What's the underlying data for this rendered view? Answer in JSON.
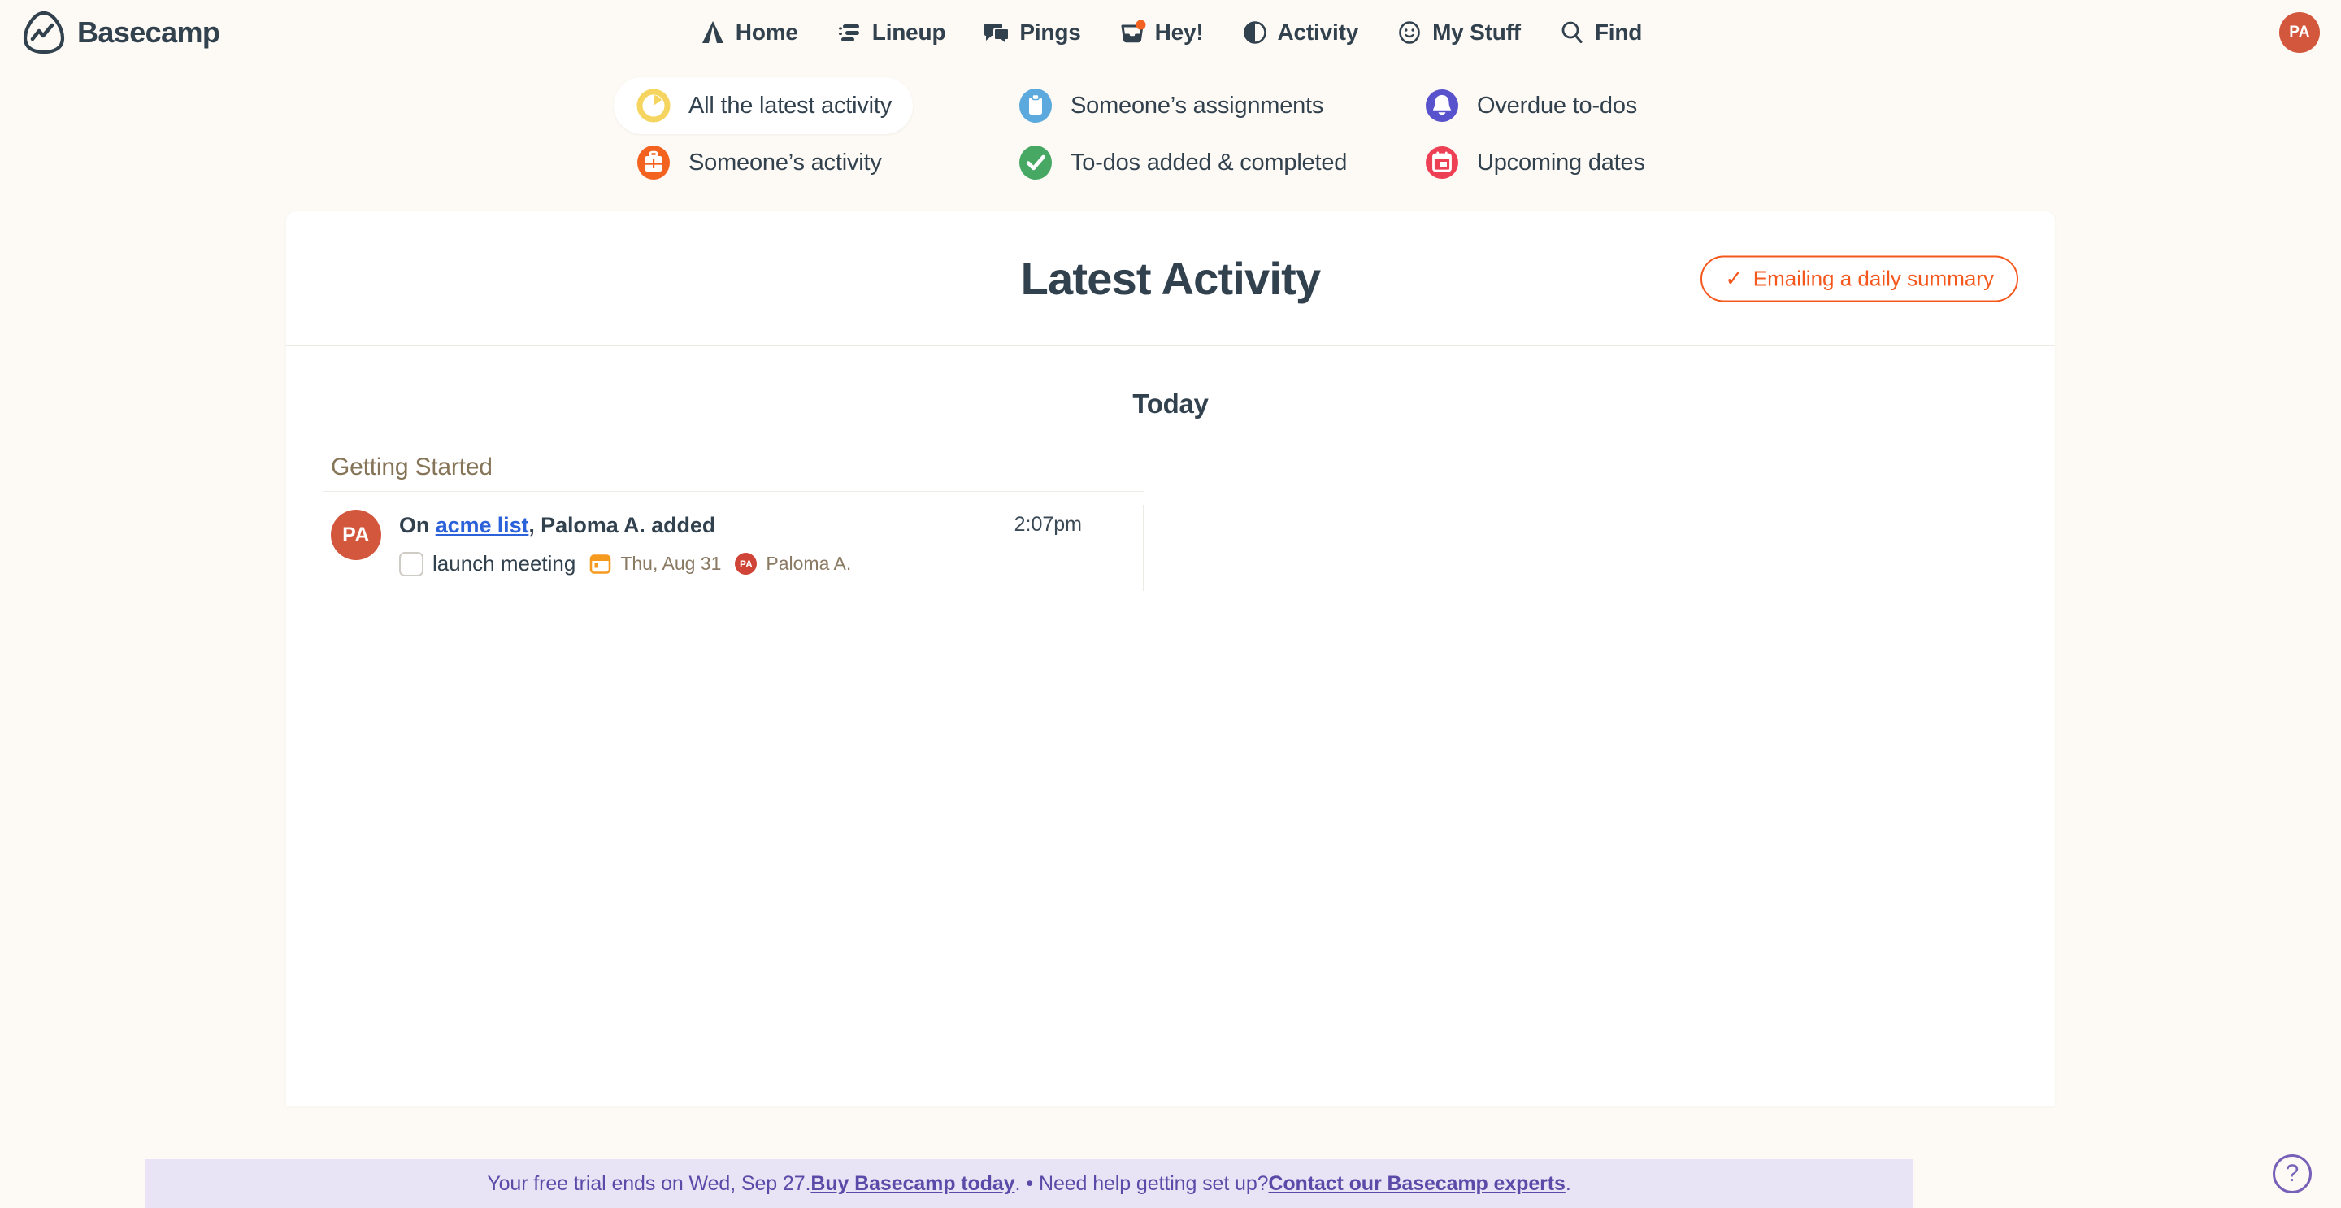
{
  "brand": {
    "name": "Basecamp",
    "logo_icon": "basecamp-logo-icon"
  },
  "nav": {
    "items": [
      {
        "label": "Home",
        "icon": "home-tent-icon"
      },
      {
        "label": "Lineup",
        "icon": "lineup-bars-icon"
      },
      {
        "label": "Pings",
        "icon": "pings-speech-bubbles-icon"
      },
      {
        "label": "Hey!",
        "icon": "hey-inbox-tray-icon",
        "badge": true
      },
      {
        "label": "Activity",
        "icon": "activity-pie-icon"
      },
      {
        "label": "My Stuff",
        "icon": "my-stuff-smiley-icon"
      },
      {
        "label": "Find",
        "icon": "find-magnifier-icon"
      }
    ],
    "avatar_initials": "PA"
  },
  "filters": [
    {
      "label": "All the latest activity",
      "icon": "clock-pie-icon",
      "color": "#f5d55f",
      "selected": true
    },
    {
      "label": "Someone’s assignments",
      "icon": "clipboard-icon",
      "color": "#5ca9dd",
      "selected": false
    },
    {
      "label": "Overdue to-dos",
      "icon": "bell-icon",
      "color": "#5852cc",
      "selected": false
    },
    {
      "label": "Someone’s activity",
      "icon": "briefcase-icon",
      "color": "#f4621f",
      "selected": false
    },
    {
      "label": "To-dos added & completed",
      "icon": "check-circle-icon",
      "color": "#47a863",
      "selected": false
    },
    {
      "label": "Upcoming dates",
      "icon": "calendar-icon",
      "color": "#ee4055",
      "selected": false
    }
  ],
  "card": {
    "title": "Latest Activity",
    "summary_button": {
      "label": "Emailing a daily summary",
      "check": "✓"
    },
    "day_heading": "Today"
  },
  "activity": {
    "group_label": "Getting Started",
    "entries": [
      {
        "avatar_initials": "PA",
        "prefix": "On ",
        "link_text": "acme list",
        "suffix": ", Paloma A. added",
        "todo_title": "launch meeting",
        "date_label": "Thu, Aug 31",
        "assignee_initials": "PA",
        "assignee_name": "Paloma A.",
        "time": "2:07pm"
      }
    ]
  },
  "footer": {
    "text_before": "Your free trial ends on Wed, Sep 27. ",
    "link_buy": "Buy Basecamp today",
    "text_middle": ". ",
    "dot": "•",
    "text_help": " Need help getting set up? ",
    "link_contact": "Contact our Basecamp experts",
    "text_end": ".",
    "help_label": "?"
  },
  "colors": {
    "page_bg": "#fdf9f4",
    "ink": "#32414e",
    "accent_orange": "#f4581d",
    "avatar_red": "#d2573c",
    "link_blue": "#2b62d9",
    "muted_brown": "#857457",
    "banner_bg": "#e8e4f6",
    "banner_text": "#5b4ba8"
  }
}
